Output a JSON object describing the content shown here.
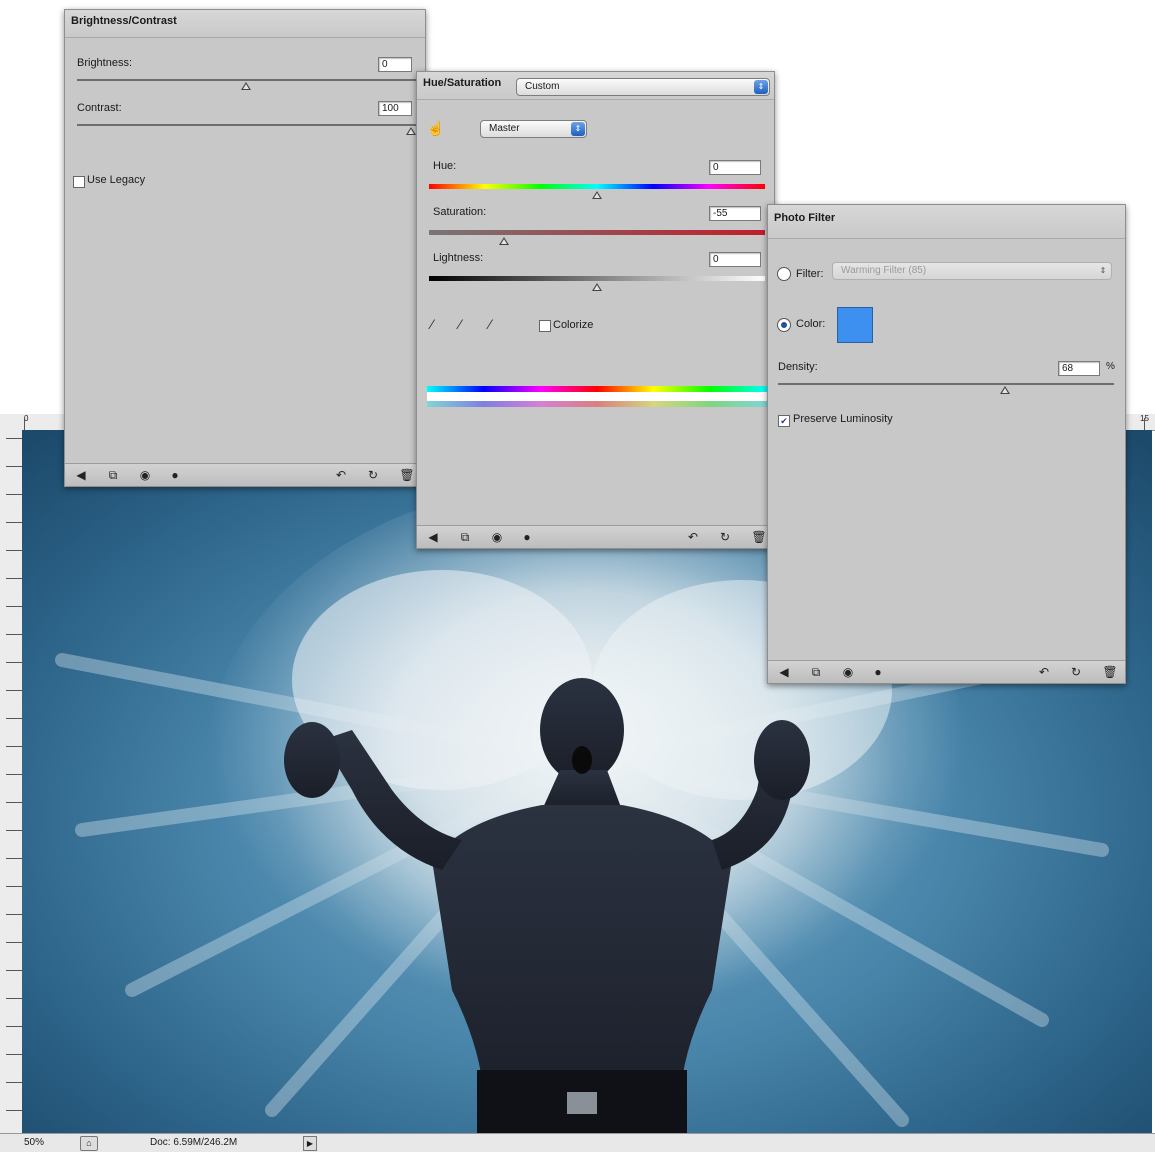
{
  "colors": {
    "panel_bg": "#c8c8c8",
    "photo_color_swatch": "#3d8ff0",
    "canvas_sky": "#2d6489"
  },
  "brightness_contrast": {
    "title": "Brightness/Contrast",
    "brightness_label": "Brightness:",
    "brightness_value": "0",
    "contrast_label": "Contrast:",
    "contrast_value": "100",
    "use_legacy_label": "Use Legacy",
    "use_legacy_checked": false
  },
  "hue_saturation": {
    "title": "Hue/Saturation",
    "preset_value": "Custom",
    "channel_value": "Master",
    "hue_label": "Hue:",
    "hue_value": "0",
    "saturation_label": "Saturation:",
    "saturation_value": "-55",
    "lightness_label": "Lightness:",
    "lightness_value": "0",
    "colorize_label": "Colorize",
    "colorize_checked": false
  },
  "photo_filter": {
    "title": "Photo Filter",
    "filter_label": "Filter:",
    "filter_value": "Warming Filter (85)",
    "color_label": "Color:",
    "density_label": "Density:",
    "density_value": "68",
    "density_unit": "%",
    "preserve_label": "Preserve Luminosity",
    "preserve_checked": true
  },
  "footer_icons": [
    "back-arrow-icon",
    "clip-layer-icon",
    "visibility-eye-icon",
    "view-previous-icon",
    "reset-icon",
    "delete-icon"
  ],
  "status": {
    "zoom": "50%",
    "doc": "Doc: 6.59M/246.2M"
  },
  "ruler": {
    "top_start": "0",
    "top_end": "15"
  }
}
